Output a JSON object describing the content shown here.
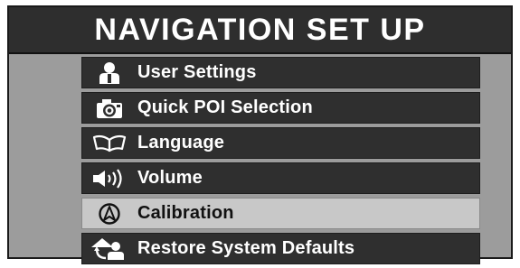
{
  "title": "NAVIGATION SET UP",
  "menu": {
    "selected_index": 4,
    "items": [
      {
        "label": "User Settings",
        "icon": "user-icon"
      },
      {
        "label": "Quick POI Selection",
        "icon": "camera-icon"
      },
      {
        "label": "Language",
        "icon": "book-icon"
      },
      {
        "label": "Volume",
        "icon": "speaker-volume-icon"
      },
      {
        "label": "Calibration",
        "icon": "compass-icon"
      },
      {
        "label": "Restore System Defaults",
        "icon": "restore-defaults-icon"
      }
    ]
  },
  "colors": {
    "screen_background": "#9c9c9c",
    "title_bar": "#2e2e2e",
    "item_background": "#2f2f2f",
    "item_selected": "#c8c8c8"
  }
}
